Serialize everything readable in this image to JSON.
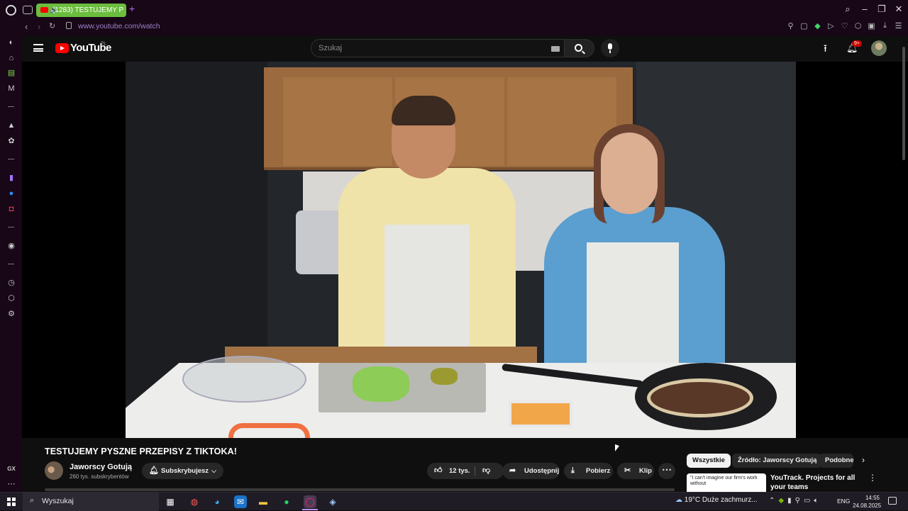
{
  "browser": {
    "active_tab_title": "(1283) TESTUJEMY P",
    "address": "www.youtube.com/watch",
    "colors": {
      "tab_accent": "#6bbd3e",
      "chrome_bg": "#170717",
      "url_text": "#a080c8"
    }
  },
  "youtube": {
    "logo_text": "YouTube",
    "region": "PL",
    "search_placeholder": "Szukaj",
    "notifications_badge": "9+"
  },
  "video": {
    "title": "TESTUJEMY PYSZNE PRZEPISY Z TIKTOKA!",
    "channel": "Jaworscy Gotują",
    "subscribers": "260 tys. subskrybentów",
    "subscribe_label": "Subskrybujesz",
    "likes": "12 tys.",
    "share_label": "Udostępnij",
    "download_label": "Pobierz",
    "clip_label": "Klip"
  },
  "chips": [
    "Wszystkie",
    "Źródło: Jaworscy Gotują",
    "Podobne"
  ],
  "recommendation": {
    "thumb_text": "\"I can't imagine our firm's work without",
    "title": "YouTrack. Projects for all your teams"
  },
  "taskbar": {
    "search_label": "Wyszukaj",
    "weather": "19°C  Duże zachmurz...",
    "language": "ENG",
    "time": "14:55",
    "date": "24.08.2025"
  }
}
